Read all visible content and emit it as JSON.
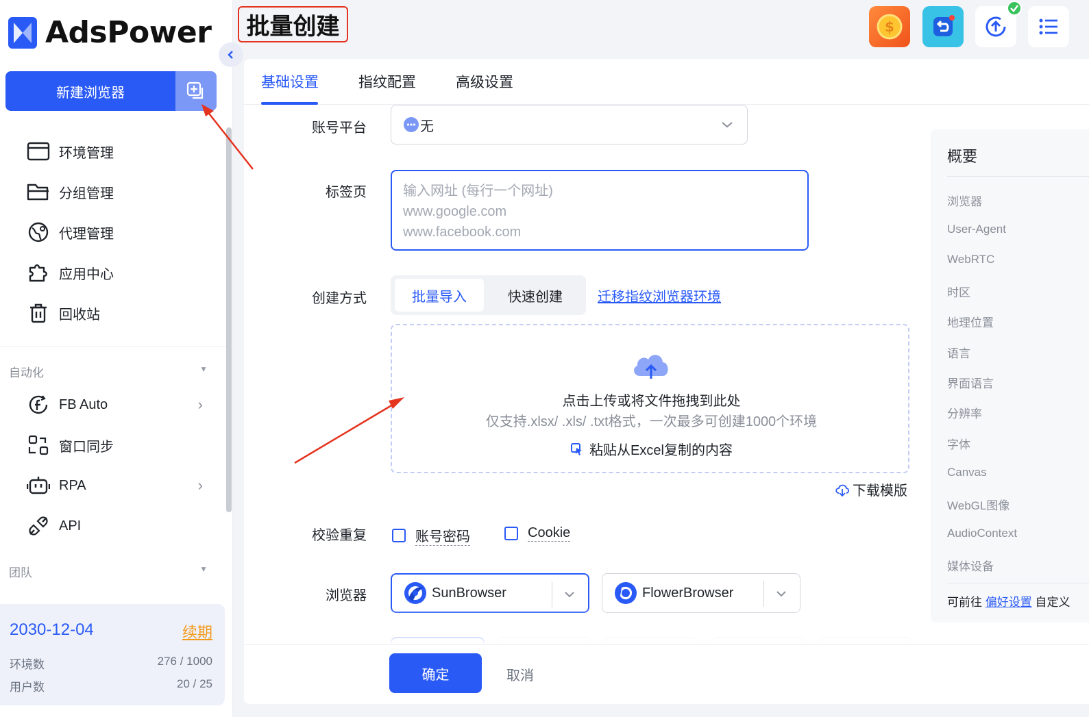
{
  "app": {
    "name": "AdsPower"
  },
  "page_title": "批量创建",
  "sidebar": {
    "new_browser_label": "新建浏览器",
    "nav": [
      {
        "label": "环境管理",
        "icon": "browser-window-icon"
      },
      {
        "label": "分组管理",
        "icon": "folder-icon"
      },
      {
        "label": "代理管理",
        "icon": "globe-icon"
      },
      {
        "label": "应用中心",
        "icon": "puzzle-icon"
      },
      {
        "label": "回收站",
        "icon": "trash-icon"
      }
    ],
    "automation_title": "自动化",
    "automation": [
      {
        "label": "FB Auto",
        "icon": "facebook-auto-icon"
      },
      {
        "label": "窗口同步",
        "icon": "window-sync-icon"
      },
      {
        "label": "RPA",
        "icon": "robot-icon"
      },
      {
        "label": "API",
        "icon": "plug-icon"
      }
    ],
    "team_title": "团队",
    "plan": {
      "expiry": "2030-12-04",
      "renew_label": "续期",
      "env_label": "环境数",
      "env_value": "276 / 1000",
      "user_label": "用户数",
      "user_value": "20 / 25"
    }
  },
  "tabs": [
    "基础设置",
    "指纹配置",
    "高级设置"
  ],
  "form": {
    "platform_label": "账号平台",
    "platform_value": "无",
    "tabs_label": "标签页",
    "tabs_placeholder_lines": [
      "输入网址 (每行一个网址)",
      "www.google.com",
      "www.facebook.com"
    ],
    "create_mode_label": "创建方式",
    "mode_batch": "批量导入",
    "mode_quick": "快速创建",
    "migrate_link": "迁移指纹浏览器环境",
    "upload_line1": "点击上传或将文件拖拽到此处",
    "upload_line2": "仅支持.xlsx/ .xls/ .txt格式，一次最多可创建1000个环境",
    "paste_label": "粘贴从Excel复制的内容",
    "download_template": "下载模版",
    "dedupe_label": "校验重复",
    "dedupe_account": "账号密码",
    "dedupe_cookie": "Cookie",
    "browser_label": "浏览器",
    "browser_sun": "SunBrowser",
    "browser_flower": "FlowerBrowser"
  },
  "footer": {
    "confirm": "确定",
    "cancel": "取消"
  },
  "summary": {
    "title": "概要",
    "items": [
      "浏览器",
      "User-Agent",
      "WebRTC",
      "时区",
      "地理位置",
      "语言",
      "界面语言",
      "分辨率",
      "字体",
      "Canvas",
      "WebGL图像",
      "AudioContext",
      "媒体设备"
    ],
    "foot_prefix": "可前往",
    "foot_link": "偏好设置",
    "foot_suffix": "自定义"
  },
  "colors": {
    "accent": "#2a5af6",
    "annotation": "#e4331e",
    "renew": "#f39a1a"
  }
}
